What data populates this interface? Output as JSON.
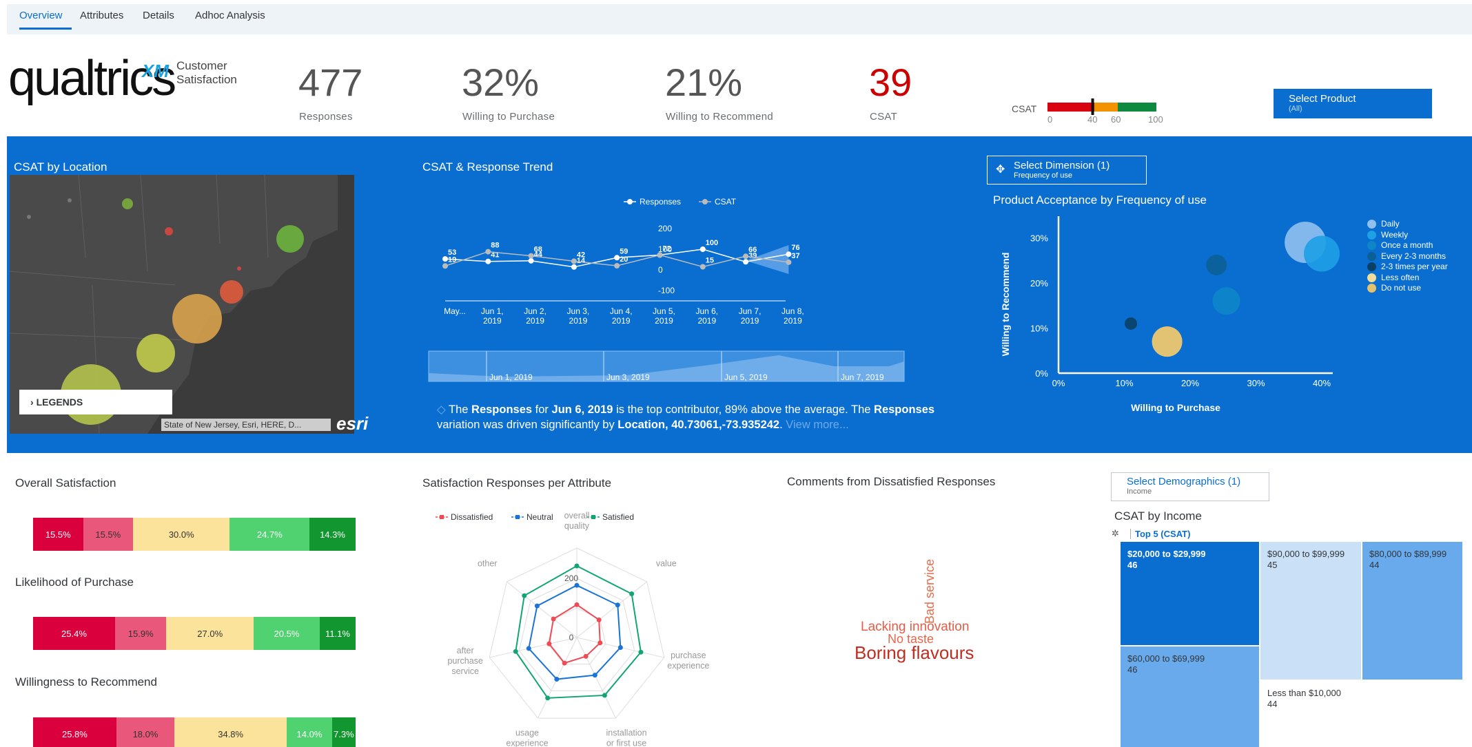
{
  "tabs": [
    {
      "label": "Overview",
      "active": true
    },
    {
      "label": "Attributes",
      "active": false
    },
    {
      "label": "Details",
      "active": false
    },
    {
      "label": "Adhoc Analysis",
      "active": false
    }
  ],
  "brand": {
    "name": "qualtrics",
    "xm": "XM",
    "subtitle": "Customer Satisfaction"
  },
  "kpis": [
    {
      "value": "477",
      "label": "Responses",
      "color": "#555555"
    },
    {
      "value": "32%",
      "label": "Willing to Purchase",
      "color": "#555555"
    },
    {
      "value": "21%",
      "label": "Willing to Recommend",
      "color": "#555555"
    },
    {
      "value": "39",
      "label": "CSAT",
      "color": "#cc0000"
    }
  ],
  "csat_gauge": {
    "label": "CSAT",
    "ticks": [
      "0",
      "40",
      "60",
      "100"
    ],
    "value": 39,
    "colors": {
      "red": "#d9000f",
      "orange": "#f39200",
      "green": "#0d8a3e"
    }
  },
  "select_product": {
    "label": "Select Product",
    "value": "(All)"
  },
  "map_panel": {
    "title": "CSAT by Location",
    "legends_label": "LEGENDS",
    "attribution": "State of New Jersey, Esri, HERE, D...",
    "esri": "esri"
  },
  "trend_panel": {
    "title": "CSAT & Response Trend",
    "legend": [
      "Responses",
      "CSAT"
    ],
    "y_ticks": [
      "200",
      "100",
      "0",
      "-100"
    ],
    "x_labels": [
      "May...",
      "Jun 1, 2019",
      "Jun 2, 2019",
      "Jun 3, 2019",
      "Jun 4, 2019",
      "Jun 5, 2019",
      "Jun 6, 2019",
      "Jun 7, 2019",
      "Jun 8, 2019"
    ],
    "navigator_labels": [
      "Jun 1, 2019",
      "Jun 3, 2019",
      "Jun 5, 2019",
      "Jun 7, 2019"
    ],
    "insight": {
      "p1": "The ",
      "b1": "Responses",
      "p2": " for ",
      "b2": "Jun 6, 2019",
      "p3": " is the top contributor, 89% above the average. The ",
      "b3": "Responses",
      "p4": " variation was driven significantly by ",
      "b4": "Location, 40.73061,-73.935242",
      "p5": ".",
      "more": "View more..."
    }
  },
  "chart_data": [
    {
      "type": "line",
      "title": "CSAT & Response Trend",
      "categories": [
        "May...",
        "Jun 1, 2019",
        "Jun 2, 2019",
        "Jun 3, 2019",
        "Jun 4, 2019",
        "Jun 5, 2019",
        "Jun 6, 2019",
        "Jun 7, 2019",
        "Jun 8, 2019"
      ],
      "ylim": [
        -100,
        200
      ],
      "series": [
        {
          "name": "Responses",
          "values": [
            53,
            41,
            44,
            14,
            59,
            72,
            100,
            39,
            76
          ],
          "labels": [
            "53",
            "41",
            "44",
            "14",
            "59",
            "72",
            "100",
            "39",
            "76"
          ]
        },
        {
          "name": "CSAT",
          "values": [
            19,
            88,
            68,
            42,
            20,
            72,
            15,
            66,
            37
          ],
          "labels": [
            "19",
            "88",
            "68",
            "42",
            "20",
            "",
            "15",
            "66",
            "37"
          ]
        }
      ]
    },
    {
      "type": "scatter",
      "title": "Product Acceptance by Frequency of use",
      "xlabel": "Willing to Purchase",
      "ylabel": "Willing to Recommend",
      "x_ticks": [
        "0%",
        "10%",
        "20%",
        "30%",
        "40%"
      ],
      "y_ticks": [
        "0%",
        "10%",
        "20%",
        "30%"
      ],
      "xlim": [
        0,
        45
      ],
      "ylim": [
        0,
        35
      ],
      "series": [
        {
          "name": "Daily",
          "x": 37.5,
          "y": 29,
          "size": 30,
          "color": "#8fc0ee"
        },
        {
          "name": "Weekly",
          "x": 40,
          "y": 26.5,
          "size": 26,
          "color": "#1ea0e5"
        },
        {
          "name": "Once a month",
          "x": 25.5,
          "y": 16,
          "size": 20,
          "color": "#0d86c8"
        },
        {
          "name": "Every 2-3 months",
          "x": 24,
          "y": 24,
          "size": 15,
          "color": "#0b5f95"
        },
        {
          "name": "2-3 times per year",
          "x": 11,
          "y": 11,
          "size": 9,
          "color": "#0a3f66"
        },
        {
          "name": "Less often",
          "x": 16.5,
          "y": 7,
          "size": 22,
          "color": "#f2dc9b"
        },
        {
          "name": "Do not use",
          "x": 16.5,
          "y": 7,
          "size": 22,
          "color": "#e2c16f"
        }
      ]
    },
    {
      "type": "bar",
      "title": "Overall Satisfaction",
      "stacked": true,
      "values": [
        15.5,
        15.5,
        30.0,
        24.7,
        14.3
      ],
      "labels": [
        "15.5%",
        "15.5%",
        "30.0%",
        "24.7%",
        "14.3%"
      ]
    },
    {
      "type": "bar",
      "title": "Likelihood of Purchase",
      "stacked": true,
      "values": [
        25.4,
        15.9,
        27.0,
        20.5,
        11.1
      ],
      "labels": [
        "25.4%",
        "15.9%",
        "27.0%",
        "20.5%",
        "11.1%"
      ]
    },
    {
      "type": "bar",
      "title": "Willingness to Recommend",
      "stacked": true,
      "values": [
        25.8,
        18.0,
        34.8,
        14.0,
        7.3
      ],
      "labels": [
        "25.8%",
        "18.0%",
        "34.8%",
        "14.0%",
        "7.3%"
      ]
    },
    {
      "type": "radar",
      "title": "Satisfaction Responses per Attribute",
      "axes": [
        "overall quality",
        "value",
        "purchase experience",
        "installation or first use",
        "usage experience",
        "after purchase service",
        "other"
      ],
      "ticks": [
        "0",
        "200"
      ],
      "series": [
        {
          "name": "Dissatisfied",
          "color": "#ee4b54",
          "values": [
            110,
            95,
            80,
            70,
            95,
            95,
            100
          ]
        },
        {
          "name": "Neutral",
          "color": "#1a73d9",
          "values": [
            175,
            175,
            150,
            140,
            155,
            165,
            170
          ]
        },
        {
          "name": "Satisfied",
          "color": "#11a572",
          "values": [
            240,
            235,
            220,
            215,
            225,
            210,
            225
          ]
        }
      ]
    },
    {
      "type": "heatmap",
      "title": "CSAT by Income",
      "tiles": [
        {
          "label": "$20,000 to $29,999",
          "value": "46"
        },
        {
          "label": "$90,000 to $99,999",
          "value": "45"
        },
        {
          "label": "$80,000 to $89,999",
          "value": "44"
        },
        {
          "label": "$60,000 to $69,999",
          "value": "46"
        },
        {
          "label": "Less than $10,000",
          "value": "44"
        }
      ]
    }
  ],
  "scatter_panel": {
    "select_label": "Select Dimension (1)",
    "select_value": "Frequency of use"
  },
  "satisfaction_colors": [
    "#d9003d",
    "#e9577a",
    "#fce39b",
    "#4fd26f",
    "#12962f"
  ],
  "radar_legend": [
    "Dissatisfied",
    "Neutral",
    "Satisfied"
  ],
  "comments_panel": {
    "title": "Comments from Dissatisfied Responses",
    "words": [
      {
        "text": "Bad service",
        "color": "#e66c4a"
      },
      {
        "text": "Lacking innovation",
        "color": "#e65c46"
      },
      {
        "text": "No taste",
        "color": "#e8664c"
      },
      {
        "text": "Boring flavours",
        "color": "#c22d22"
      }
    ]
  },
  "demographics": {
    "select_label": "Select Demographics (1)",
    "select_value": "Income",
    "title": "CSAT by Income",
    "filter": "Top 5 (CSAT)"
  }
}
